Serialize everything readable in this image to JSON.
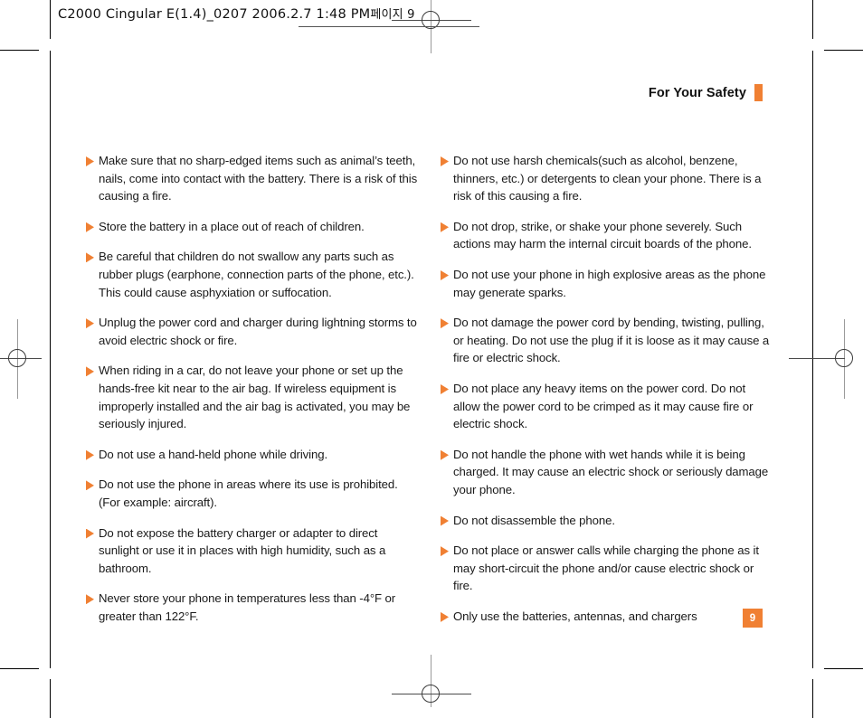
{
  "header": {
    "running_header_text": "C2000 Cingular  E(1.4)_0207  2006.2.7 1:48 PM",
    "running_header_korean": "페이지 9",
    "section_title": "For Your Safety"
  },
  "page_number": "9",
  "colors": {
    "accent_orange": "#F08033",
    "text": "#1a1a1a",
    "page_background": "#ffffff"
  },
  "content": {
    "left_column": [
      "Make sure that no sharp-edged items such as animal’s teeth, nails, come into contact with the battery. There is a risk of this causing a fire.",
      "Store the battery in a place out of reach of children.",
      "Be careful that children do not swallow any parts such as rubber plugs (earphone, connection parts of the phone, etc.). This could cause asphyxiation or suffocation.",
      "Unplug the power cord and charger during lightning storms to avoid electric shock or fire.",
      "When riding in a car, do not leave your phone or set up the hands-free kit near to the air bag. If wireless equipment is improperly installed and the air bag is activated, you may be seriously injured.",
      "Do not use a hand-held phone while driving.",
      "Do not use the phone in areas where its use is prohibited. (For example: aircraft).",
      "Do not expose the battery charger or adapter to direct sunlight or use it in places with high humidity, such as a bathroom.",
      "Never store your phone in temperatures less than -4°F or greater than 122°F."
    ],
    "right_column": [
      "Do not use harsh chemicals(such as alcohol, benzene, thinners, etc.) or detergents to clean your phone. There is a risk of this causing a fire.",
      "Do not drop, strike, or shake your phone severely. Such actions may harm the internal circuit boards of the phone.",
      "Do not use your phone in high explosive areas as the phone may generate sparks.",
      "Do not damage the power cord by bending, twisting, pulling, or heating. Do not use the plug if it is loose as it may cause a fire or electric shock.",
      "Do not place any heavy items on the power cord. Do not allow the power cord to be crimped as it may cause fire or electric shock.",
      "Do not handle the phone with wet hands while it is being charged. It may cause an electric shock or seriously damage your phone.",
      "Do not disassemble the phone.",
      "Do not place or answer calls while charging the phone as it may short-circuit the phone and/or cause electric shock or fire.",
      "Only use the batteries, antennas, and chargers"
    ]
  }
}
